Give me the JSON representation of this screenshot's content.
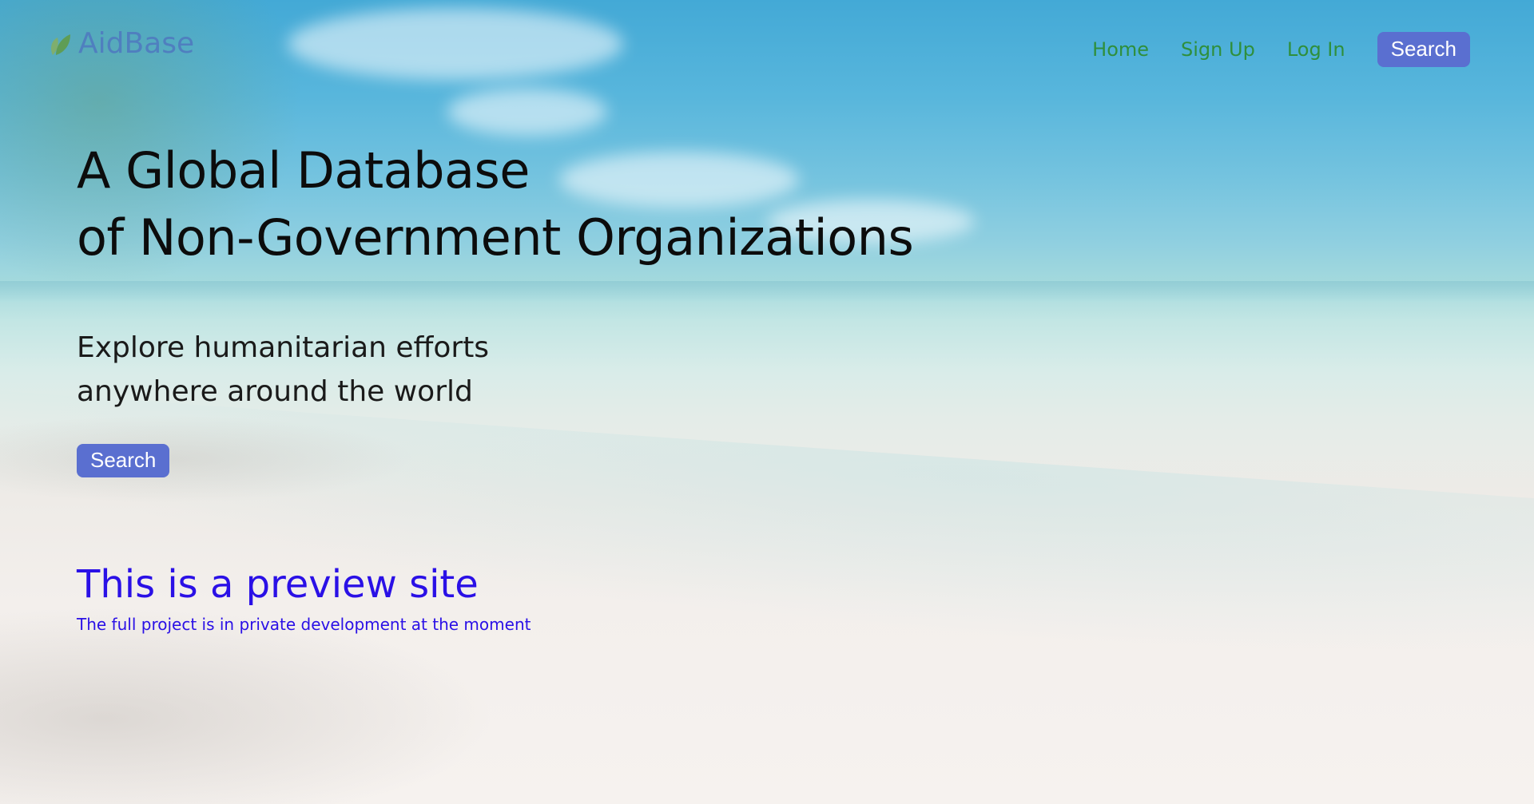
{
  "brand": {
    "name": "AidBase",
    "icon": "leaf-icon",
    "color": "#4f7fbf"
  },
  "nav": {
    "links": [
      {
        "label": "Home"
      },
      {
        "label": "Sign Up"
      },
      {
        "label": "Log In"
      }
    ],
    "search_label": "Search",
    "link_color": "#2f8f3c",
    "button_color": "#5a6fd0"
  },
  "hero": {
    "title_line1": "A Global Database",
    "title_line2": "of Non-Government Organizations",
    "subtitle_line1": "Explore humanitarian efforts",
    "subtitle_line2": "anywhere around the world",
    "search_label": "Search"
  },
  "preview": {
    "title": "This is a preview site",
    "note": "The full project is in private development at the moment",
    "color": "#2a10e6"
  }
}
